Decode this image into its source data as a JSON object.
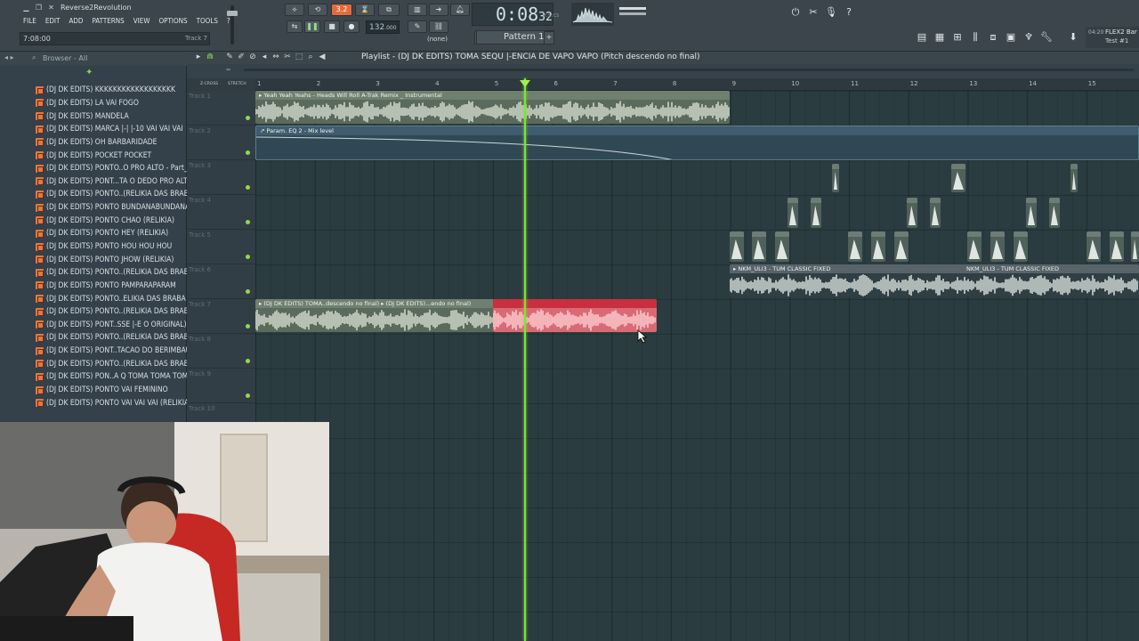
{
  "window": {
    "title": "Reverse2Revolution"
  },
  "menu": [
    "FILE",
    "EDIT",
    "ADD",
    "PATTERNS",
    "VIEW",
    "OPTIONS",
    "TOOLS",
    "?"
  ],
  "hint": {
    "left": "7:08:00",
    "right": "Track 7"
  },
  "transport": {
    "mode_indicator": "3.2",
    "tempo": "132",
    "tempo_decimals": ".000",
    "time_main": "0:08",
    "time_ms": "32",
    "time_unit": "M:S:CS",
    "pattern": "Pattern 1",
    "none_label": "(none)"
  },
  "right_panel": {
    "line1": "04:20",
    "line2": "FLEX2 Bar",
    "line3": "Test #1"
  },
  "browser": {
    "header": "Browser - All",
    "items": [
      "(DJ DK EDITS) KKKKKKKKKKKKKKKKKK",
      "(DJ DK EDITS) LA VAI FOGO",
      "(DJ DK EDITS) MANDELA",
      "(DJ DK EDITS) MARCA |-| |-10 VAI VAI VAI",
      "(DJ DK EDITS) OH BARBARIDADE",
      "(DJ DK EDITS) POCKET POCKET",
      "(DJ DK EDITS) PONTO..O PRO ALTO - Part_1",
      "(DJ DK EDITS) PONT...TA O DEDO PRO ALTO",
      "(DJ DK EDITS) PONTO..(RELIKIA DAS BRABA)",
      "(DJ DK EDITS) PONTO BUNDANABUNDANA",
      "(DJ DK EDITS) PONTO CHAO (RELIKIA)",
      "(DJ DK EDITS) PONTO HEY (RELIKIA)",
      "(DJ DK EDITS) PONTO HOU HOU HOU",
      "(DJ DK EDITS) PONTO JHOW (RELIKIA)",
      "(DJ DK EDITS) PONTO..(RELIKIA DAS BRABA)",
      "(DJ DK EDITS) PONTO PAMPARAPARAM",
      "(DJ DK EDITS) PONTO..ELIKIA DAS BRABA 2)",
      "(DJ DK EDITS) PONTO..(RELIKIA DAS BRABA)",
      "(DJ DK EDITS) PONT..SSE |-E O ORIGINAL)",
      "(DJ DK EDITS) PONTO..(RELIKIA DAS BRABA)",
      "(DJ DK EDITS) PONT..TACAO DO BERIMBAU",
      "(DJ DK EDITS) PONTO..(RELIKIA DAS BRABA)",
      "(DJ DK EDITS) PON..A Q TOMA TOMA TOMA",
      "(DJ DK EDITS) PONTO VAI FEMININO",
      "(DJ DK EDITS) PONTO VAI VAI VAI (RELIKIA)"
    ]
  },
  "playlist": {
    "title": "Playlist - (DJ DK EDITS) TOMA SEQU |-ENCIA DE VAPO VAPO (Pitch descendo no final)",
    "ruler": [
      "1",
      "2",
      "3",
      "4",
      "5",
      "6",
      "7",
      "8",
      "9",
      "10",
      "11",
      "12",
      "13",
      "14",
      "15"
    ],
    "ruler_labels": [
      "Z-CROSS",
      "STRETCH"
    ],
    "tracks": [
      "Track 1",
      "Track 2",
      "Track 3",
      "Track 4",
      "Track 5",
      "Track 6",
      "Track 7",
      "Track 8",
      "Track 9",
      "Track 10"
    ],
    "clips": {
      "track1": "Yeah Yeah Yeahs - Heads Will Roll A-Trak Remix _ Instrumental",
      "track2": "Param. EQ 2 - Mix level",
      "track6a": "NKM_ULI3 - TUM CLASSIC FIXED",
      "track6b": "NKM_ULI3 - TUM CLASSIC FIXED",
      "track7a": "(DJ DK EDITS) TOMA..descendo no final)",
      "track7b": "(DJ DK EDITS)...endo no final)"
    }
  },
  "colors": {
    "playhead": "#7fe13b",
    "selected_clip": "#c8303f",
    "accent": "#e46a3c"
  }
}
